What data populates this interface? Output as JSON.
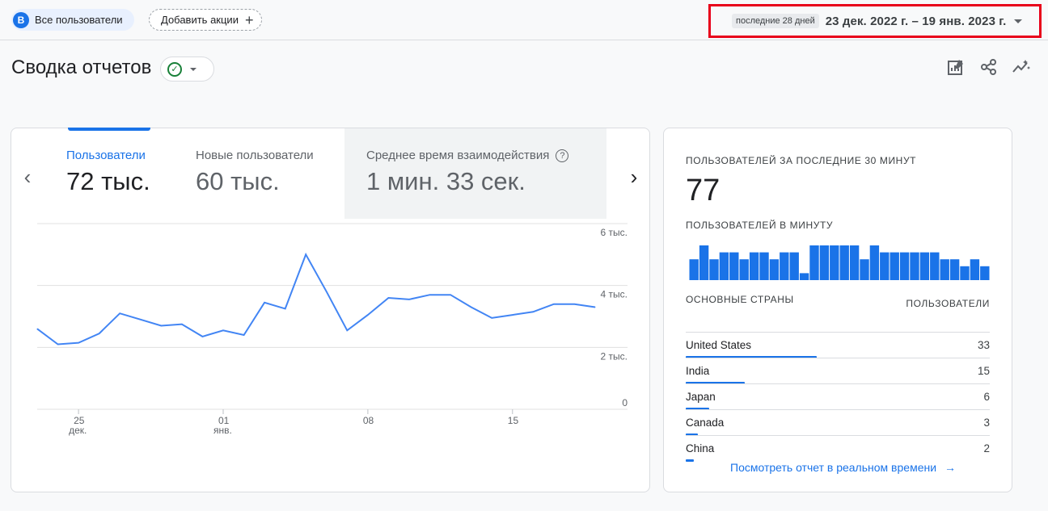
{
  "topbar": {
    "segment_letter": "В",
    "segment_label": "Все пользователи",
    "add_actions_label": "Добавить акции",
    "date_preset": "последние 28 дней",
    "date_range": "23 дек. 2022 г. – 19 янв. 2023 г."
  },
  "header": {
    "title": "Сводка отчетов"
  },
  "tools": [
    "customize-report-icon",
    "share-icon",
    "insights-icon"
  ],
  "metrics": [
    {
      "label": "Пользователи",
      "value": "72 тыс."
    },
    {
      "label": "Новые пользователи",
      "value": "60 тыс."
    },
    {
      "label": "Среднее время взаимодействия",
      "value": "1 мин. 33 сек."
    }
  ],
  "chart_data": {
    "type": "line",
    "series": [
      {
        "values": [
          2600,
          2100,
          2150,
          2450,
          3100,
          2900,
          2700,
          2750,
          2350,
          2550,
          2400,
          3450,
          3250,
          5000,
          3800,
          2550,
          3050,
          3600,
          3550,
          3700,
          3700,
          3300,
          2950,
          3050,
          3150,
          3400,
          3400,
          3300
        ]
      }
    ],
    "x": [
      "2022-12-23",
      "2022-12-24",
      "2022-12-25",
      "2022-12-26",
      "2022-12-27",
      "2022-12-28",
      "2022-12-29",
      "2022-12-30",
      "2022-12-31",
      "2023-01-01",
      "2023-01-02",
      "2023-01-03",
      "2023-01-04",
      "2023-01-05",
      "2023-01-06",
      "2023-01-07",
      "2023-01-08",
      "2023-01-09",
      "2023-01-10",
      "2023-01-11",
      "2023-01-12",
      "2023-01-13",
      "2023-01-14",
      "2023-01-15",
      "2023-01-16",
      "2023-01-17",
      "2023-01-18",
      "2023-01-19"
    ],
    "ylim": [
      0,
      6000
    ],
    "y_ticks": [
      "0",
      "2 тыс.",
      "4 тыс.",
      "6 тыс."
    ],
    "x_ticks": [
      {
        "day": "25",
        "month": "дек."
      },
      {
        "day": "01",
        "month": "янв."
      },
      {
        "day": "08",
        "month": ""
      },
      {
        "day": "15",
        "month": ""
      }
    ],
    "color": "#4285f4",
    "grid": true
  },
  "realtime": {
    "title": "ПОЛЬЗОВАТЕЛЕЙ ЗА ПОСЛЕДНИЕ 30 МИНУТ",
    "count": "77",
    "per_minute_title": "ПОЛЬЗОВАТЕЛЕЙ В МИНУТУ",
    "per_minute": [
      3,
      5,
      3,
      4,
      4,
      3,
      4,
      4,
      3,
      4,
      4,
      1,
      5,
      5,
      5,
      5,
      5,
      3,
      5,
      4,
      4,
      4,
      4,
      4,
      4,
      3,
      3,
      2,
      3,
      2
    ],
    "countries_head": "ОСНОВНЫЕ СТРАНЫ",
    "users_head": "ПОЛЬЗОВАТЕЛИ",
    "countries": [
      {
        "name": "United States",
        "value": "33",
        "share": 1.0
      },
      {
        "name": "India",
        "value": "15",
        "share": 0.45
      },
      {
        "name": "Japan",
        "value": "6",
        "share": 0.18
      },
      {
        "name": "Canada",
        "value": "3",
        "share": 0.09
      },
      {
        "name": "China",
        "value": "2",
        "share": 0.06
      }
    ],
    "link_label": "Посмотреть отчет в реальном времени"
  }
}
